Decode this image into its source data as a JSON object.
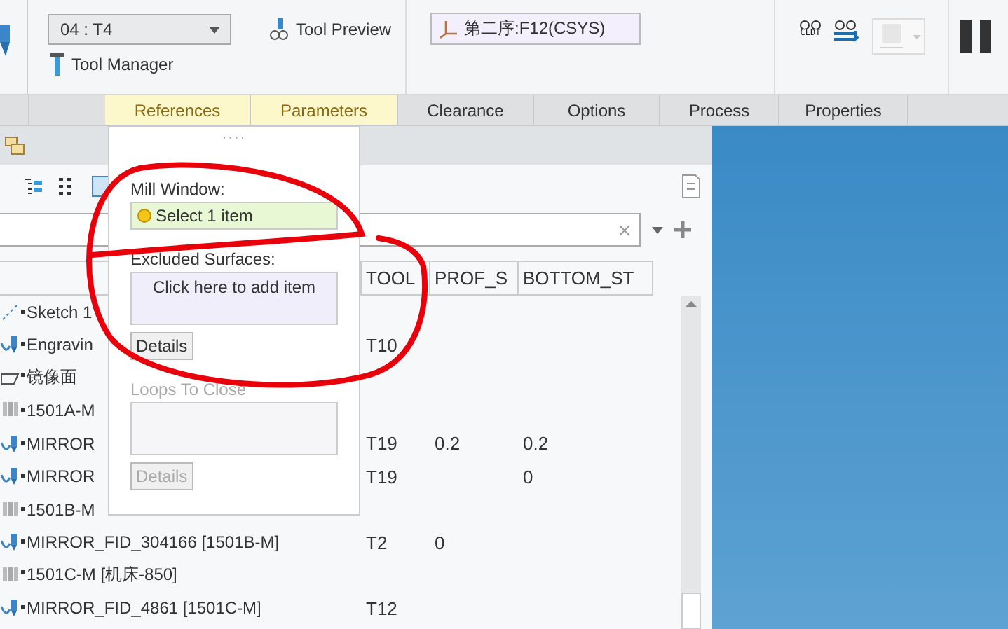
{
  "ribbon": {
    "tool_select": {
      "value": "04 : T4"
    },
    "tool_manager": "Tool Manager",
    "tool_preview": "Tool Preview",
    "step_orientation": {
      "value": "第二序:F12(CSYS)"
    },
    "cldt_label": "CLDT",
    "tool_display": {
      "disabled": true
    }
  },
  "tabs": [
    {
      "label": "References",
      "highlighted": true
    },
    {
      "label": "Parameters",
      "highlighted": true
    },
    {
      "label": "Clearance",
      "highlighted": false
    },
    {
      "label": "Options",
      "highlighted": false
    },
    {
      "label": "Process",
      "highlighted": false
    },
    {
      "label": "Properties",
      "highlighted": false
    }
  ],
  "references_panel": {
    "grip": "····",
    "sections": [
      {
        "label": "Mill Window:",
        "value": "Select 1 item",
        "selected": true,
        "disabled": false
      },
      {
        "label": "Excluded Surfaces:",
        "value": "Click here to add item",
        "selected": false,
        "disabled": false,
        "button": "Details"
      },
      {
        "label": "Loops To Close",
        "selected": false,
        "disabled": true,
        "button": "Details"
      }
    ]
  },
  "tree": {
    "columns": [
      "TOOL",
      "PROF_S",
      "BOTTOM_ST"
    ],
    "rows": [
      {
        "kind": "sketch",
        "name": "Sketch 1",
        "cells": [
          "",
          "",
          ""
        ]
      },
      {
        "kind": "toolpath",
        "name": "Engravin",
        "cells": [
          "T10",
          "",
          ""
        ]
      },
      {
        "kind": "plane",
        "name": "镜像面",
        "cells": [
          "",
          "",
          ""
        ]
      },
      {
        "kind": "operation",
        "name": "1501A-M",
        "cells": [
          "",
          "",
          ""
        ]
      },
      {
        "kind": "toolpath",
        "name": "MIRROR",
        "cells": [
          "T19",
          "0.2",
          "0.2"
        ]
      },
      {
        "kind": "toolpath",
        "name": "MIRROR",
        "cells": [
          "T19",
          "",
          "0"
        ]
      },
      {
        "kind": "operation",
        "name": "1501B-M",
        "cells": [
          "",
          "",
          ""
        ]
      },
      {
        "kind": "toolpath",
        "name": "MIRROR_FID_304166 [1501B-M]",
        "cells": [
          "T2",
          "0",
          ""
        ]
      },
      {
        "kind": "operation",
        "name": "1501C-M [机床-850]",
        "cells": [
          "",
          "",
          ""
        ]
      },
      {
        "kind": "toolpath",
        "name": "MIRROR_FID_4861 [1501C-M]",
        "cells": [
          "T12",
          "",
          ""
        ]
      }
    ]
  }
}
